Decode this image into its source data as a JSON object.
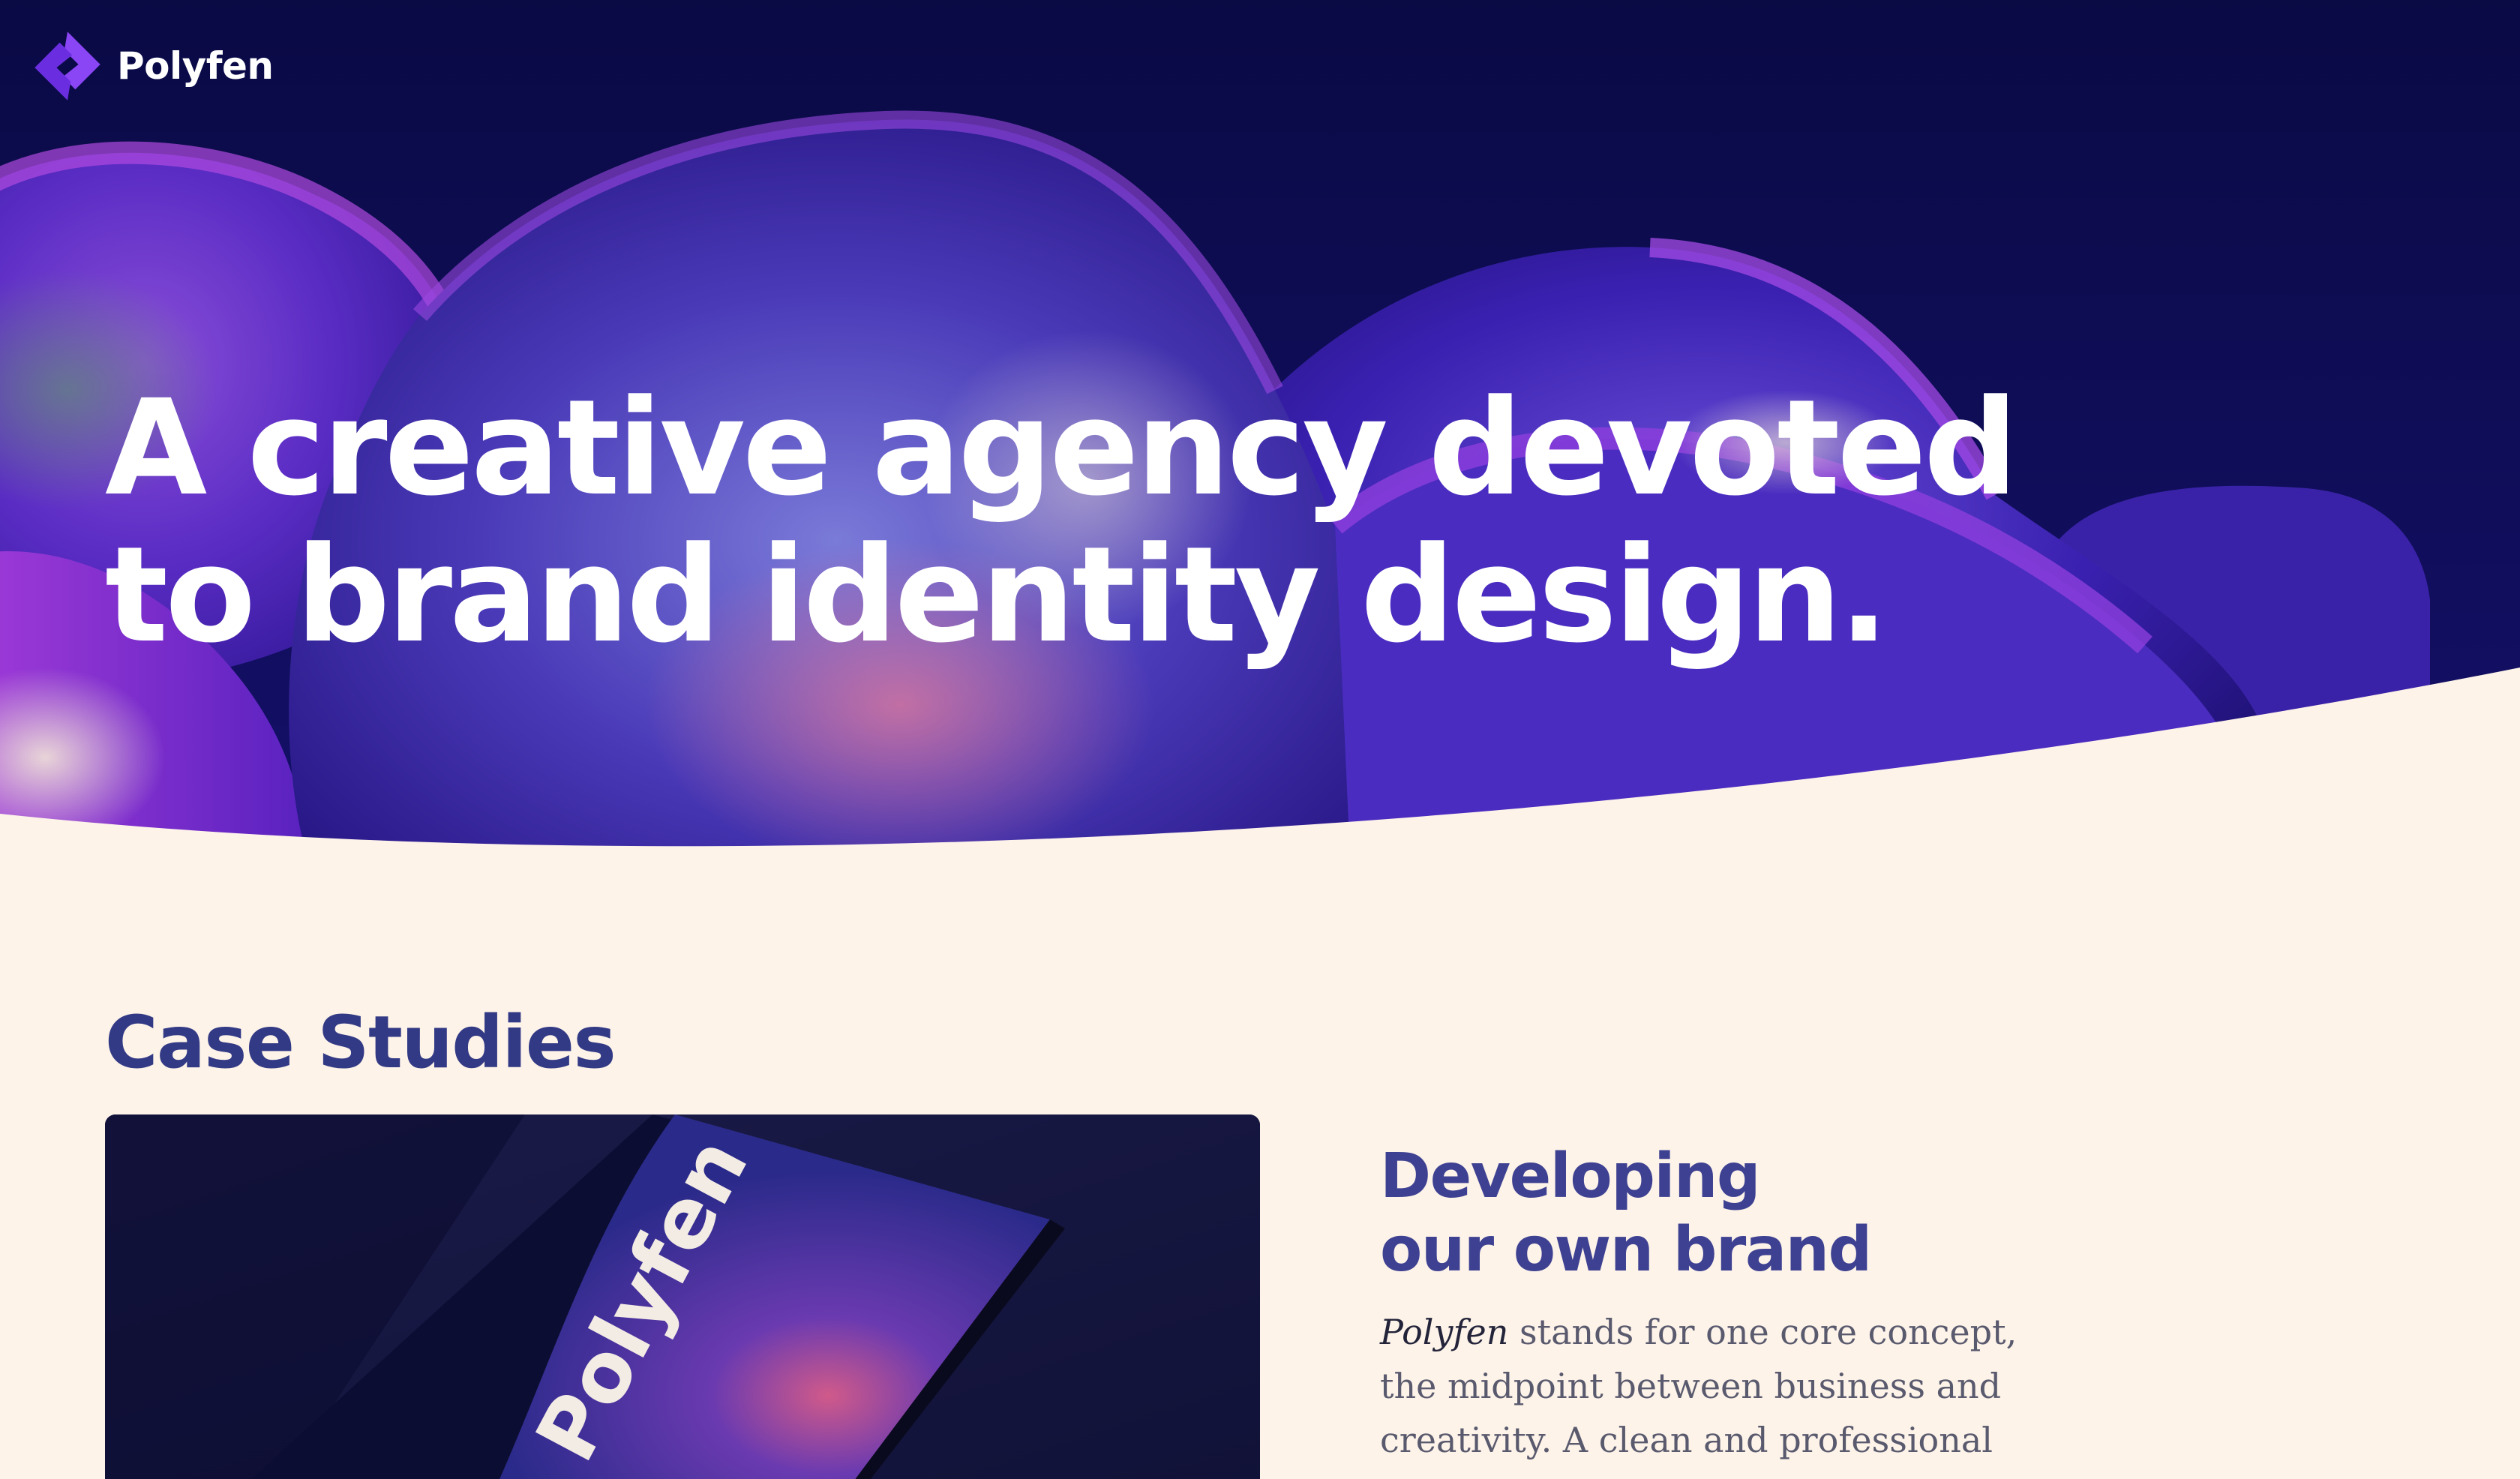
{
  "header": {
    "brand_name": "Polyfen",
    "logo_icon": "polyfen-diamond-logo"
  },
  "hero": {
    "headline_line1": "A creative agency devoted",
    "headline_line2": "to brand identity design."
  },
  "case_studies": {
    "section_title": "Case Studies",
    "items": [
      {
        "card_image_text": "Polyfen",
        "title_line1": "Developing",
        "title_line2": "our own brand",
        "description_lead": "Polyfen",
        "description_rest": " stands for one core concept, the midpoint between business and creativity. A clean and professional"
      }
    ]
  },
  "colors": {
    "hero_navy": "#0a0a45",
    "blob_purple": "#4a25c9",
    "cream_background": "#fdf3e9",
    "heading_indigo": "#333a85",
    "logo_violet": "#7b3cf0"
  }
}
